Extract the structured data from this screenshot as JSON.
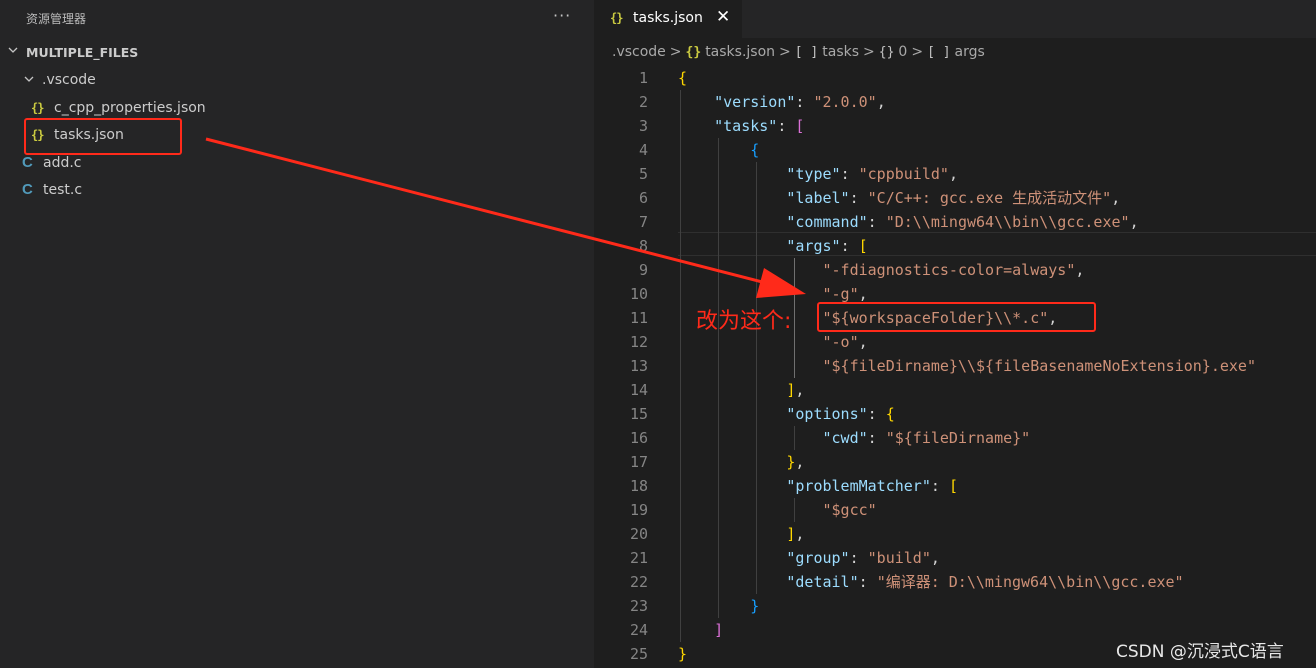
{
  "sidebar": {
    "title": "资源管理器",
    "more_icon": "ellipsis-icon",
    "root_folder": "MULTIPLE_FILES",
    "items": [
      {
        "label": ".vscode",
        "type": "folder"
      },
      {
        "label": "c_cpp_properties.json",
        "type": "json",
        "icon": "{}"
      },
      {
        "label": "tasks.json",
        "type": "json",
        "icon": "{}"
      },
      {
        "label": "add.c",
        "type": "c",
        "icon": "C"
      },
      {
        "label": "test.c",
        "type": "c",
        "icon": "C"
      }
    ]
  },
  "editor": {
    "tab": {
      "icon": "{}",
      "label": "tasks.json",
      "close": "✕"
    },
    "breadcrumbs": [
      {
        "icon": "",
        "label": ".vscode"
      },
      {
        "icon": "{}",
        "label": "tasks.json"
      },
      {
        "icon": "[ ]",
        "label": "tasks"
      },
      {
        "icon": "{}",
        "label": "0"
      },
      {
        "icon": "[ ]",
        "label": "args"
      }
    ],
    "code_lines": [
      {
        "n": "1",
        "parts": [
          [
            "b1",
            "{"
          ]
        ]
      },
      {
        "n": "2",
        "parts": [
          [
            "p",
            "    "
          ],
          [
            "k",
            "\"version\""
          ],
          [
            "p",
            ": "
          ],
          [
            "s",
            "\"2.0.0\""
          ],
          [
            "p",
            ","
          ]
        ]
      },
      {
        "n": "3",
        "parts": [
          [
            "p",
            "    "
          ],
          [
            "k",
            "\"tasks\""
          ],
          [
            "p",
            ": "
          ],
          [
            "b2",
            "["
          ]
        ]
      },
      {
        "n": "4",
        "parts": [
          [
            "p",
            "        "
          ],
          [
            "b3",
            "{"
          ]
        ]
      },
      {
        "n": "5",
        "parts": [
          [
            "p",
            "            "
          ],
          [
            "k",
            "\"type\""
          ],
          [
            "p",
            ": "
          ],
          [
            "s",
            "\"cppbuild\""
          ],
          [
            "p",
            ","
          ]
        ]
      },
      {
        "n": "6",
        "parts": [
          [
            "p",
            "            "
          ],
          [
            "k",
            "\"label\""
          ],
          [
            "p",
            ": "
          ],
          [
            "s",
            "\"C/C++: gcc.exe 生成活动文件\""
          ],
          [
            "p",
            ","
          ]
        ]
      },
      {
        "n": "7",
        "parts": [
          [
            "p",
            "            "
          ],
          [
            "k",
            "\"command\""
          ],
          [
            "p",
            ": "
          ],
          [
            "s",
            "\"D:\\\\mingw64\\\\bin\\\\gcc.exe\""
          ],
          [
            "p",
            ","
          ]
        ]
      },
      {
        "n": "8",
        "parts": [
          [
            "p",
            "            "
          ],
          [
            "k",
            "\"args\""
          ],
          [
            "p",
            ": "
          ],
          [
            "b1",
            "["
          ]
        ]
      },
      {
        "n": "9",
        "parts": [
          [
            "p",
            "                "
          ],
          [
            "s",
            "\"-fdiagnostics-color=always\""
          ],
          [
            "p",
            ","
          ]
        ]
      },
      {
        "n": "10",
        "parts": [
          [
            "p",
            "                "
          ],
          [
            "s",
            "\"-g\""
          ],
          [
            "p",
            ","
          ]
        ]
      },
      {
        "n": "11",
        "parts": [
          [
            "p",
            "                "
          ],
          [
            "s",
            "\"${workspaceFolder}\\\\*.c\""
          ],
          [
            "p",
            ","
          ]
        ]
      },
      {
        "n": "12",
        "parts": [
          [
            "p",
            "                "
          ],
          [
            "s",
            "\"-o\""
          ],
          [
            "p",
            ","
          ]
        ]
      },
      {
        "n": "13",
        "parts": [
          [
            "p",
            "                "
          ],
          [
            "s",
            "\"${fileDirname}\\\\${fileBasenameNoExtension}.exe\""
          ]
        ]
      },
      {
        "n": "14",
        "parts": [
          [
            "p",
            "            "
          ],
          [
            "b1",
            "]"
          ],
          [
            "p",
            ","
          ]
        ]
      },
      {
        "n": "15",
        "parts": [
          [
            "p",
            "            "
          ],
          [
            "k",
            "\"options\""
          ],
          [
            "p",
            ": "
          ],
          [
            "b1",
            "{"
          ]
        ]
      },
      {
        "n": "16",
        "parts": [
          [
            "p",
            "                "
          ],
          [
            "k",
            "\"cwd\""
          ],
          [
            "p",
            ": "
          ],
          [
            "s",
            "\"${fileDirname}\""
          ]
        ]
      },
      {
        "n": "17",
        "parts": [
          [
            "p",
            "            "
          ],
          [
            "b1",
            "}"
          ],
          [
            "p",
            ","
          ]
        ]
      },
      {
        "n": "18",
        "parts": [
          [
            "p",
            "            "
          ],
          [
            "k",
            "\"problemMatcher\""
          ],
          [
            "p",
            ": "
          ],
          [
            "b1",
            "["
          ]
        ]
      },
      {
        "n": "19",
        "parts": [
          [
            "p",
            "                "
          ],
          [
            "s",
            "\"$gcc\""
          ]
        ]
      },
      {
        "n": "20",
        "parts": [
          [
            "p",
            "            "
          ],
          [
            "b1",
            "]"
          ],
          [
            "p",
            ","
          ]
        ]
      },
      {
        "n": "21",
        "parts": [
          [
            "p",
            "            "
          ],
          [
            "k",
            "\"group\""
          ],
          [
            "p",
            ": "
          ],
          [
            "s",
            "\"build\""
          ],
          [
            "p",
            ","
          ]
        ]
      },
      {
        "n": "22",
        "parts": [
          [
            "p",
            "            "
          ],
          [
            "k",
            "\"detail\""
          ],
          [
            "p",
            ": "
          ],
          [
            "s",
            "\"编译器: D:\\\\mingw64\\\\bin\\\\gcc.exe\""
          ]
        ]
      },
      {
        "n": "23",
        "parts": [
          [
            "p",
            "        "
          ],
          [
            "b3",
            "}"
          ]
        ]
      },
      {
        "n": "24",
        "parts": [
          [
            "p",
            "    "
          ],
          [
            "b2",
            "]"
          ]
        ]
      },
      {
        "n": "25",
        "parts": [
          [
            "b1",
            "}"
          ]
        ]
      }
    ]
  },
  "annotation": {
    "text": "改为这个:",
    "color": "#ff2a1a"
  },
  "watermark": "CSDN @沉浸式C语言",
  "colors": {
    "key": "#9cdcfe",
    "string": "#ce9178",
    "bracket_gold": "#ffd700",
    "bracket_pink": "#da70d6",
    "bracket_blue": "#179fff",
    "json_icon": "#cbcb41",
    "c_icon": "#519aba"
  }
}
